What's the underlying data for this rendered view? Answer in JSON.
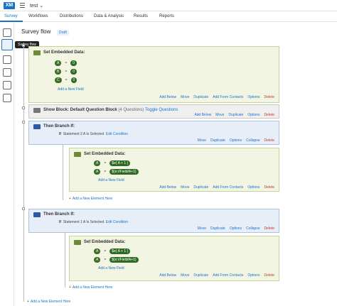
{
  "app": {
    "logo": "XM",
    "project": "test ⌄"
  },
  "tabs": [
    {
      "label": "Survey"
    },
    {
      "label": "Workflows"
    },
    {
      "label": "Distributions"
    },
    {
      "label": "Data & Analysis"
    },
    {
      "label": "Results"
    },
    {
      "label": "Reports"
    }
  ],
  "rail": {
    "tooltip": "Survey flow"
  },
  "header": {
    "title": "Survey flow",
    "badge": "Draft"
  },
  "block1": {
    "title": "Set Embedded Data:",
    "fields": [
      {
        "name": "A",
        "eq": "=",
        "value": "0"
      },
      {
        "name": "B",
        "eq": "=",
        "value": "0"
      },
      {
        "name": "C",
        "eq": "=",
        "value": "0"
      }
    ],
    "add_field": "Add a New Field",
    "actions": [
      "Add Below",
      "Move",
      "Duplicate",
      "Add From Contacts",
      "Options",
      "Delete"
    ]
  },
  "block2": {
    "title": "Show Block: Default Question Block",
    "sub": "(4 Questions)",
    "toggle": "Toggle Questions",
    "actions": [
      "Add Below",
      "Move",
      "Duplicate",
      "Options",
      "Delete"
    ]
  },
  "branch1": {
    "title": "Then Branch If:",
    "cond_if": "If",
    "cond_text": "Statement 2  A  Is Selected",
    "edit": "Edit Condition",
    "actions": [
      "Move",
      "Duplicate",
      "Options",
      "Collapse",
      "Delete"
    ],
    "embedded": {
      "title": "Set Embedded Data:",
      "fields": [
        {
          "name": "A",
          "eq": "=",
          "value": "$e{ A + 1 }"
        },
        {
          "name": "A",
          "eq": "=",
          "value": "${e://Field/A+1}"
        }
      ],
      "add_field": "Add a New Field",
      "actions": [
        "Add Below",
        "Move",
        "Duplicate",
        "Add From Contacts",
        "Options",
        "Delete"
      ]
    },
    "add_element": "Add a New Element Here"
  },
  "branch2": {
    "title": "Then Branch If:",
    "cond_if": "If",
    "cond_text": "Statement 1  A  Is Selected",
    "edit": "Edit Condition",
    "actions": [
      "Move",
      "Duplicate",
      "Options",
      "Collapse",
      "Delete"
    ],
    "embedded": {
      "title": "Set Embedded Data:",
      "fields": [
        {
          "name": "A",
          "eq": "=",
          "value": "$e{ A + 1 }"
        },
        {
          "name": "A",
          "eq": "=",
          "value": "${e://Field/A+1}"
        }
      ],
      "add_field": "Add a New Field",
      "actions": [
        "Add Below",
        "Move",
        "Duplicate",
        "Add From Contacts",
        "Options",
        "Delete"
      ]
    },
    "add_element": "Add a New Element Here"
  },
  "root": {
    "add_element": "Add a New Element Here"
  }
}
